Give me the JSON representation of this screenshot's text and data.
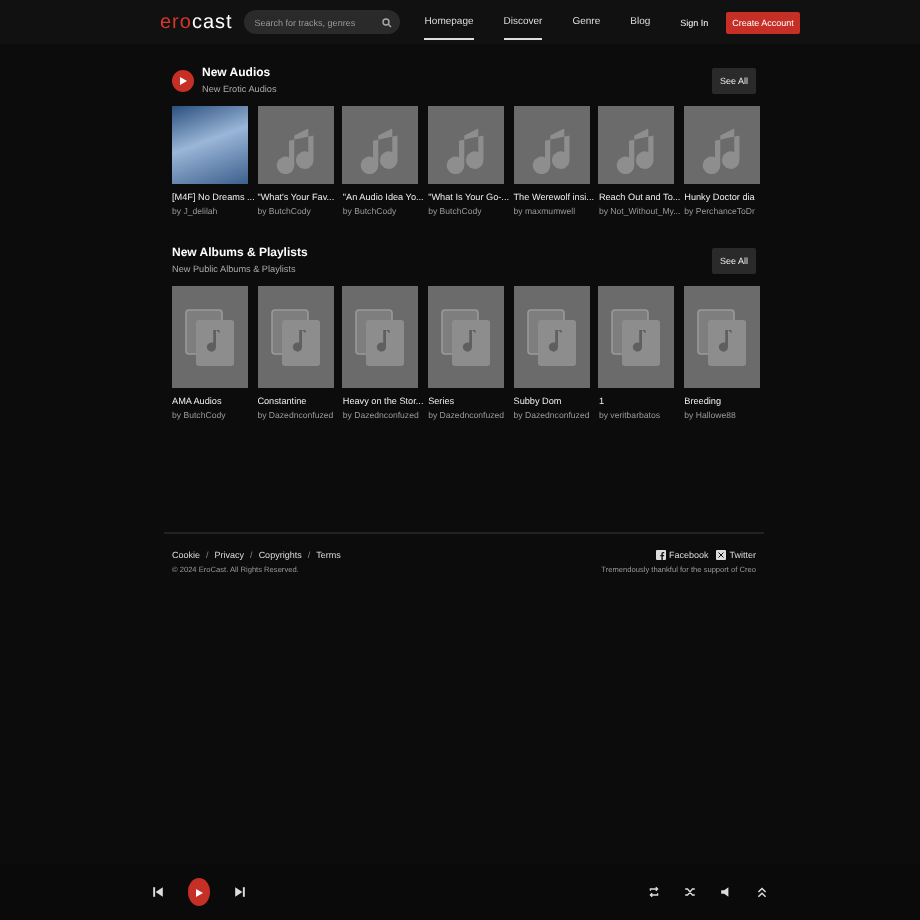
{
  "header": {
    "logo": {
      "accent": "ero",
      "rest": "cast"
    },
    "search": {
      "placeholder": "Search for tracks, genres"
    },
    "nav": [
      {
        "label": "Homepage",
        "selected": true
      },
      {
        "label": "Discover",
        "selected": true
      },
      {
        "label": "Genre",
        "selected": false
      },
      {
        "label": "Blog",
        "selected": false
      }
    ],
    "sign_in": "Sign In",
    "create_account": "Create Account"
  },
  "sections": [
    {
      "kind": "audios",
      "title": "New Audios",
      "subtitle": "New Erotic Audios",
      "see_all": "See All",
      "items": [
        {
          "kind": "photo",
          "title": "[M4F] No Dreams ...",
          "author": "by J_delilah"
        },
        {
          "kind": "note",
          "title": "\"What's Your Fav...",
          "author": "by ButchCody"
        },
        {
          "kind": "note",
          "title": "\"An Audio Idea Yo...",
          "author": "by ButchCody"
        },
        {
          "kind": "note",
          "title": "\"What Is Your Go-...",
          "author": "by ButchCody"
        },
        {
          "kind": "note",
          "title": "The Werewolf insi...",
          "author": "by maxmumwell"
        },
        {
          "kind": "note",
          "title": "Reach Out and To...",
          "author": "by Not_Without_My..."
        },
        {
          "kind": "note",
          "title": "Hunky Doctor dia",
          "author": "by PerchanceToDr"
        }
      ]
    },
    {
      "kind": "playlists",
      "title": "New Albums & Playlists",
      "subtitle": "New Public Albums & Playlists",
      "see_all": "See All",
      "items": [
        {
          "kind": "album",
          "title": "AMA Audios",
          "author": "by ButchCody"
        },
        {
          "kind": "album",
          "title": "Constantine",
          "author": "by Dazednconfuzed"
        },
        {
          "kind": "album",
          "title": "Heavy on the Stor...",
          "author": "by Dazednconfuzed"
        },
        {
          "kind": "album",
          "title": "Series",
          "author": "by Dazednconfuzed"
        },
        {
          "kind": "album",
          "title": "Subby Dom",
          "author": "by Dazednconfuzed"
        },
        {
          "kind": "album",
          "title": "1",
          "author": "by veritbarbatos"
        },
        {
          "kind": "album",
          "title": "Breeding",
          "author": "by Hallowe88"
        }
      ]
    }
  ],
  "footer": {
    "links": [
      "Cookie",
      "Privacy",
      "Copyrights",
      "Terms"
    ],
    "separator": "/",
    "copyright": "© 2024 EroCast. All Rights Reserved.",
    "social": [
      "Facebook",
      "Twitter"
    ],
    "thanks": "Tremendously thankful for the support of Creo"
  }
}
